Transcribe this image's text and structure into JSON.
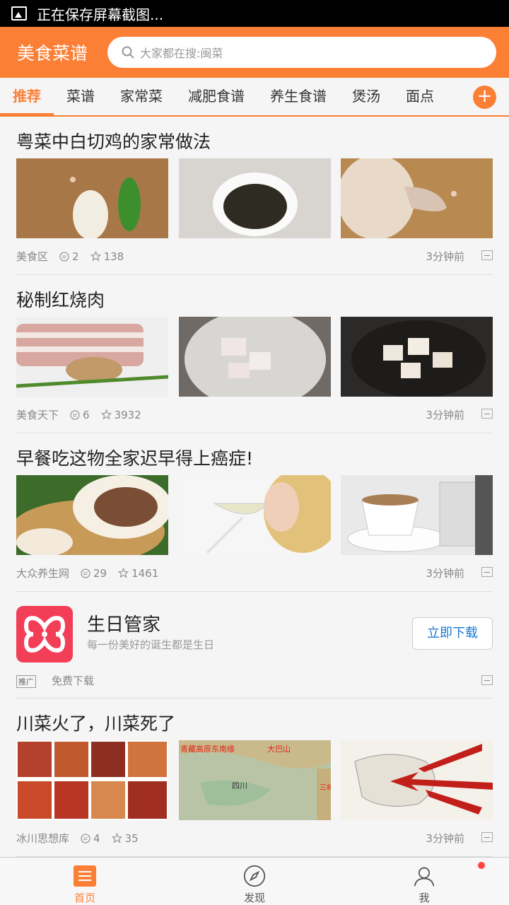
{
  "status_bar": {
    "text": "正在保存屏幕截图..."
  },
  "header": {
    "app_title": "美食菜谱",
    "search_placeholder": "大家都在搜:闽菜"
  },
  "tabs": [
    {
      "label": "推荐",
      "active": true
    },
    {
      "label": "菜谱"
    },
    {
      "label": "家常菜"
    },
    {
      "label": "减肥食谱"
    },
    {
      "label": "养生食谱"
    },
    {
      "label": "煲汤"
    },
    {
      "label": "面点"
    }
  ],
  "articles": [
    {
      "title": "粤菜中白切鸡的家常做法",
      "source": "美食区",
      "comments": "2",
      "stars": "138",
      "time": "3分钟前"
    },
    {
      "title": "秘制红烧肉",
      "source": "美食天下",
      "comments": "6",
      "stars": "3932",
      "time": "3分钟前"
    },
    {
      "title": "早餐吃这物全家迟早得上癌症!",
      "source": "大众养生网",
      "comments": "29",
      "stars": "1461",
      "time": "3分钟前"
    },
    {
      "title": "川菜火了，川菜死了",
      "source": "冰川思想库",
      "comments": "4",
      "stars": "35",
      "time": "3分钟前"
    }
  ],
  "ad": {
    "app_name": "生日管家",
    "description": "每一份美好的诞生都是生日",
    "button": "立即下载",
    "badge": "推广",
    "free_download": "免费下载"
  },
  "map_labels": {
    "plateau": "青藏高原东南缘",
    "mountain": "大巴山",
    "province": "四川",
    "gorge": "三峡"
  },
  "bottom_nav": [
    {
      "label": "首页",
      "active": true
    },
    {
      "label": "发现"
    },
    {
      "label": "我"
    }
  ],
  "colors": {
    "accent": "#fc7f36",
    "ad_icon": "#f33e58",
    "link": "#1a78d2"
  }
}
